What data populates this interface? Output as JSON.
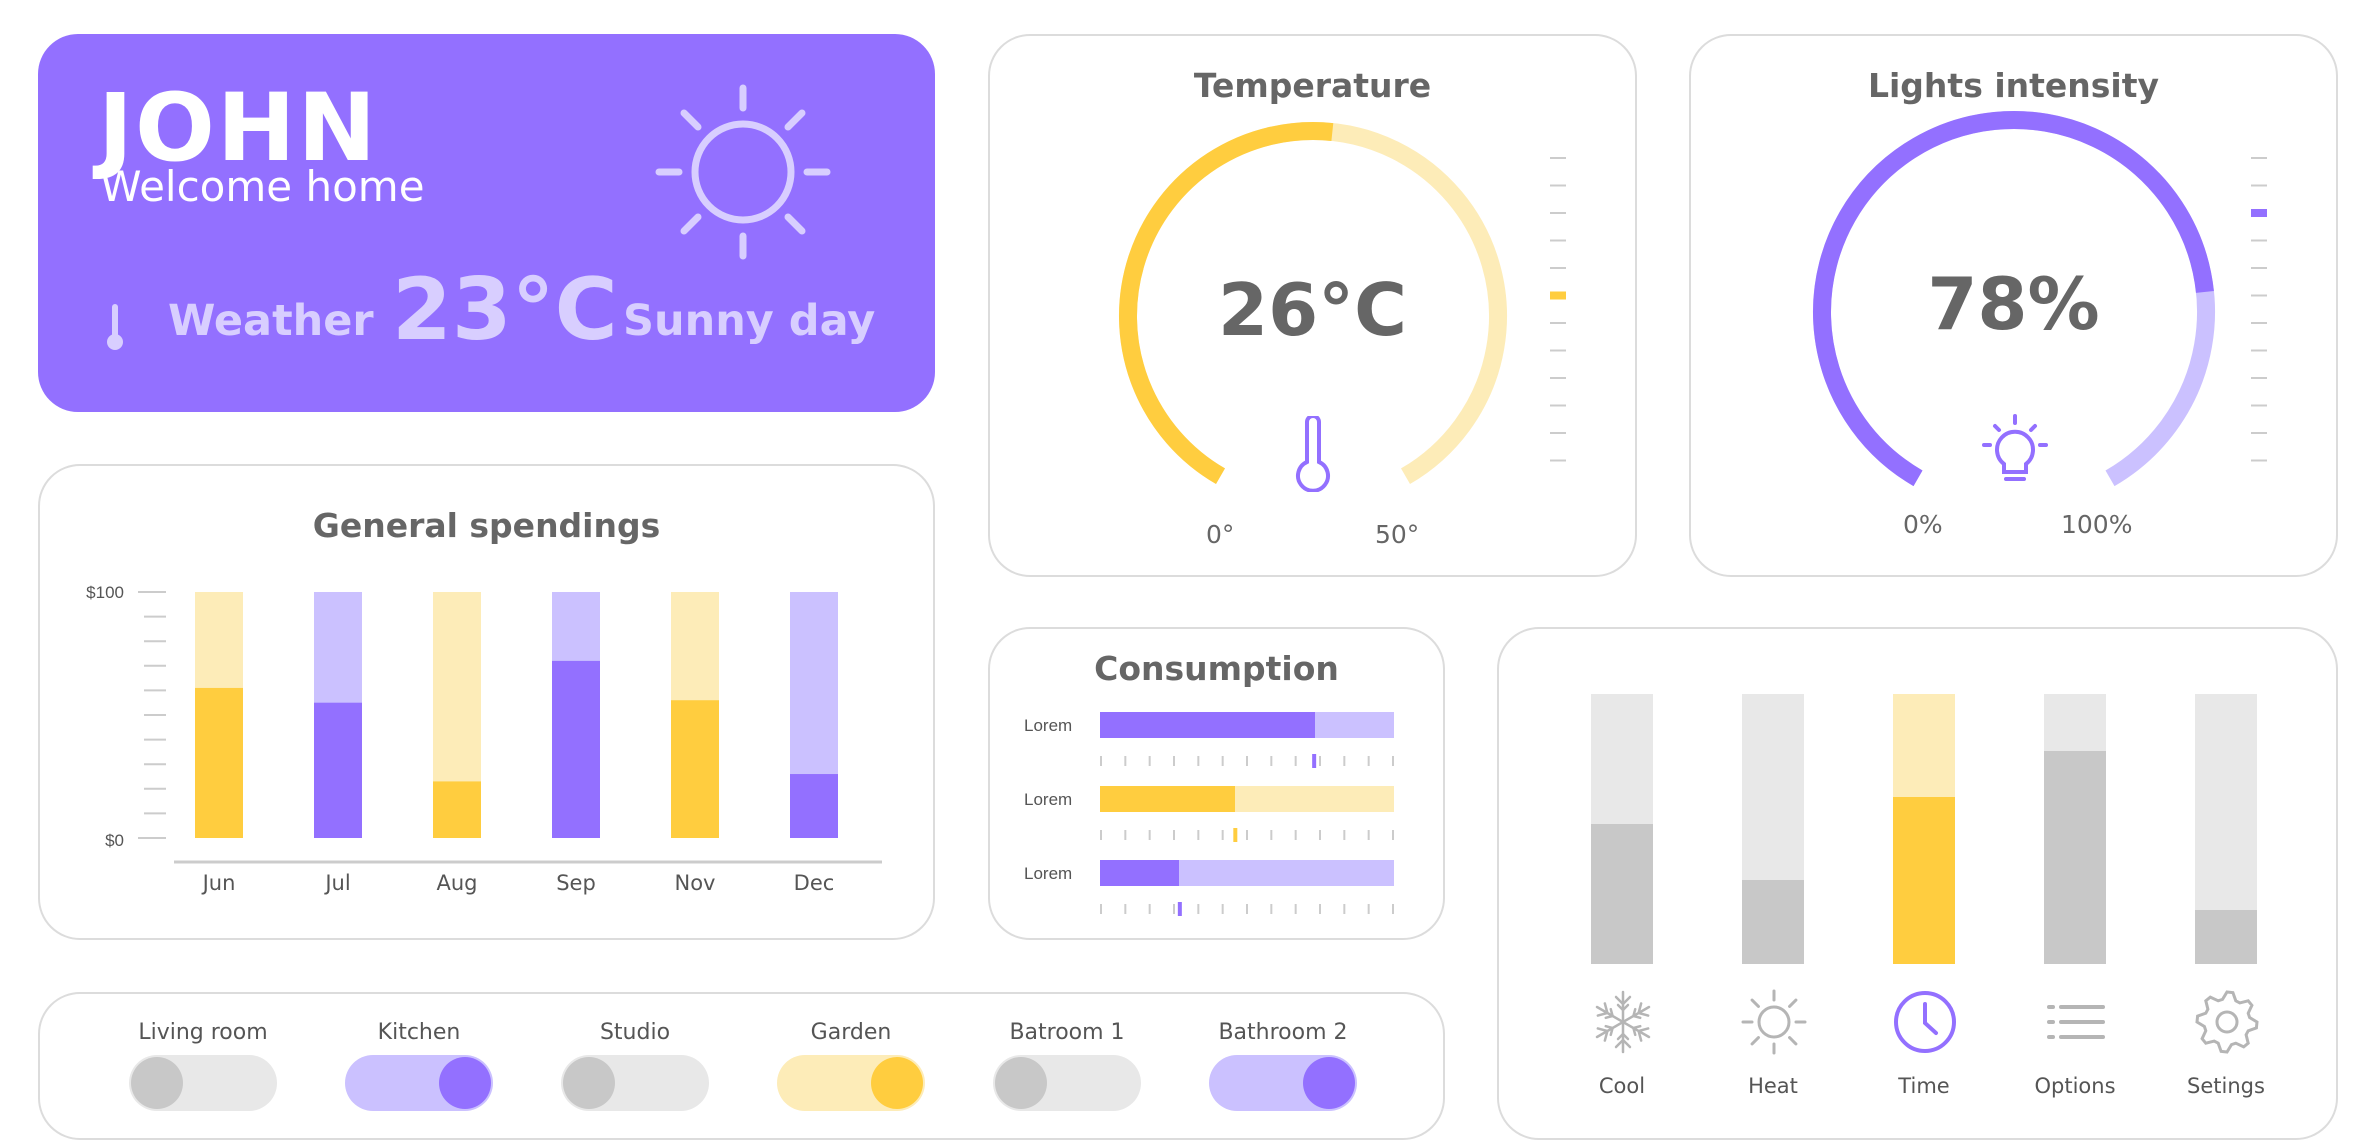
{
  "welcome": {
    "name": "JOHN",
    "subtitle": "Welcome home",
    "weather_label": "Weather",
    "weather_temp": "23°C",
    "weather_desc": "Sunny day",
    "icons": [
      "thermometer-icon",
      "sun-icon"
    ]
  },
  "temperature": {
    "title": "Temperature",
    "value": "26°C",
    "min_label": "0°",
    "max_label": "50°",
    "level": 0.52,
    "icon": "thermometer-icon",
    "colors": {
      "accent": "#ffcd3f",
      "track": "#fdecb8"
    }
  },
  "lights": {
    "title": "Lights intensity",
    "value": "78%",
    "min_label": "0%",
    "max_label": "100%",
    "level": 0.78,
    "icon": "lightbulb-icon",
    "colors": {
      "accent": "#9370ff",
      "track": "#cbc1ff"
    }
  },
  "spendings": {
    "title": "General spendings",
    "ymax_label": "$100",
    "ymin_label": "$0"
  },
  "chart_data": {
    "type": "bar",
    "title": "General spendings",
    "categories": [
      "Jun",
      "Jul",
      "Aug",
      "Sep",
      "Nov",
      "Dec"
    ],
    "values": [
      61,
      55,
      23,
      72,
      56,
      26
    ],
    "ylim": [
      0,
      100
    ],
    "ytick_labels": [
      "$0",
      "$100"
    ],
    "bar_colors": [
      "#ffcd3f",
      "#9370ff",
      "#ffcd3f",
      "#9370ff",
      "#ffcd3f",
      "#9370ff"
    ],
    "track_colors": [
      "#fdecb8",
      "#cbc1ff",
      "#fdecb8",
      "#cbc1ff",
      "#fdecb8",
      "#cbc1ff"
    ],
    "grid": false,
    "legend": "none"
  },
  "consumption": {
    "title": "Consumption",
    "rows": [
      {
        "label": "Lorem",
        "level": 0.73,
        "color": "#9370ff",
        "track": "#cbc1ff"
      },
      {
        "label": "Lorem",
        "level": 0.46,
        "color": "#ffcd3f",
        "track": "#fdecb8"
      },
      {
        "label": "Lorem",
        "level": 0.27,
        "color": "#9370ff",
        "track": "#cbc1ff"
      }
    ]
  },
  "rooms": [
    {
      "label": "Living room",
      "on": false,
      "color": "#c8c8c8",
      "track": "#e8e8e8"
    },
    {
      "label": "Kitchen",
      "on": true,
      "color": "#9370ff",
      "track": "#cbc1ff"
    },
    {
      "label": "Studio",
      "on": false,
      "color": "#c8c8c8",
      "track": "#e8e8e8"
    },
    {
      "label": "Garden",
      "on": true,
      "color": "#ffcd3f",
      "track": "#fdecb8"
    },
    {
      "label": "Batroom 1",
      "on": false,
      "color": "#c8c8c8",
      "track": "#e8e8e8"
    },
    {
      "label": "Bathroom 2",
      "on": true,
      "color": "#9370ff",
      "track": "#cbc1ff"
    }
  ],
  "controls": [
    {
      "label": "Cool",
      "icon": "snowflake-icon",
      "level": 0.52,
      "color": "#c8c8c8",
      "track": "#e8e8e8"
    },
    {
      "label": "Heat",
      "icon": "sun-icon",
      "level": 0.31,
      "color": "#c8c8c8",
      "track": "#e8e8e8"
    },
    {
      "label": "Time",
      "icon": "clock-icon",
      "level": 0.62,
      "color": "#ffcd3f",
      "track": "#fdecb8",
      "active": true
    },
    {
      "label": "Options",
      "icon": "list-icon",
      "level": 0.79,
      "color": "#c8c8c8",
      "track": "#e8e8e8"
    },
    {
      "label": "Setings",
      "icon": "gear-icon",
      "level": 0.2,
      "color": "#c8c8c8",
      "track": "#e8e8e8"
    }
  ]
}
